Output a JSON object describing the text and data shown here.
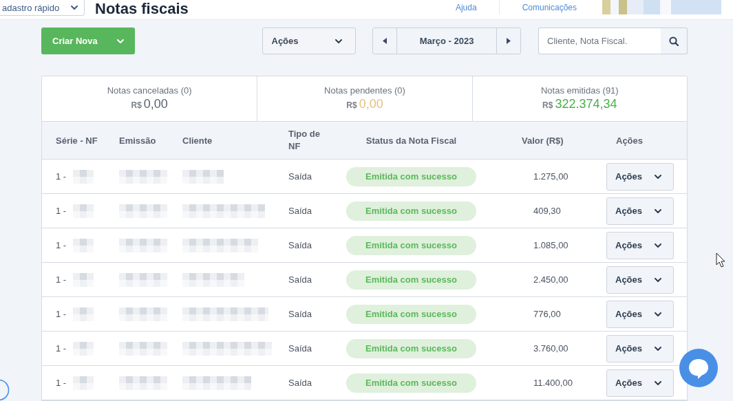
{
  "top_bar": {
    "quick_add_button": {
      "label": "adastro rápido"
    },
    "title": "Notas fiscais",
    "links": [
      {
        "label": "Ajuda"
      },
      {
        "label": "Comunicações"
      }
    ]
  },
  "toolbar": {
    "create_button": {
      "label": "Criar Nova"
    },
    "actions_dropdown": {
      "label": "Ações"
    },
    "period_picker": {
      "label": "Março - 2023"
    },
    "search": {
      "placeholder": "Cliente, Nota Fiscal."
    }
  },
  "summary": [
    {
      "label": "Notas canceladas (0)",
      "currency": "R$",
      "amount": "0,00",
      "color": "#59616d"
    },
    {
      "label": "Notas pendentes (0)",
      "currency": "R$",
      "amount": "0,00",
      "color": "#e6c07f"
    },
    {
      "label": "Notas emitidas (91)",
      "currency": "R$",
      "amount": "322.374,34",
      "color": "#4cae4c"
    }
  ],
  "table": {
    "columns": [
      "Série - NF",
      "Emissão",
      "Cliente",
      "Tipo de NF",
      "Status da Nota Fiscal",
      "Valor (R$)",
      "Ações"
    ],
    "rows": [
      {
        "series_nf": "1 -",
        "type": "Saída",
        "status": "Emitida com sucesso",
        "value": "1.275,00",
        "action": "Ações"
      },
      {
        "series_nf": "1 -",
        "type": "Saída",
        "status": "Emitida com sucesso",
        "value": "409,30",
        "action": "Ações"
      },
      {
        "series_nf": "1 -",
        "type": "Saída",
        "status": "Emitida com sucesso",
        "value": "1.085,00",
        "action": "Ações"
      },
      {
        "series_nf": "1 -",
        "type": "Saída",
        "status": "Emitida com sucesso",
        "value": "2.450,00",
        "action": "Ações"
      },
      {
        "series_nf": "1 -",
        "type": "Saída",
        "status": "Emitida com sucesso",
        "value": "776,00",
        "action": "Ações"
      },
      {
        "series_nf": "1 -",
        "type": "Saída",
        "status": "Emitida com sucesso",
        "value": "3.760,00",
        "action": "Ações"
      },
      {
        "series_nf": "1 -",
        "type": "Saída",
        "status": "Emitida com sucesso",
        "value": "11.400,00",
        "action": "Ações"
      }
    ]
  }
}
